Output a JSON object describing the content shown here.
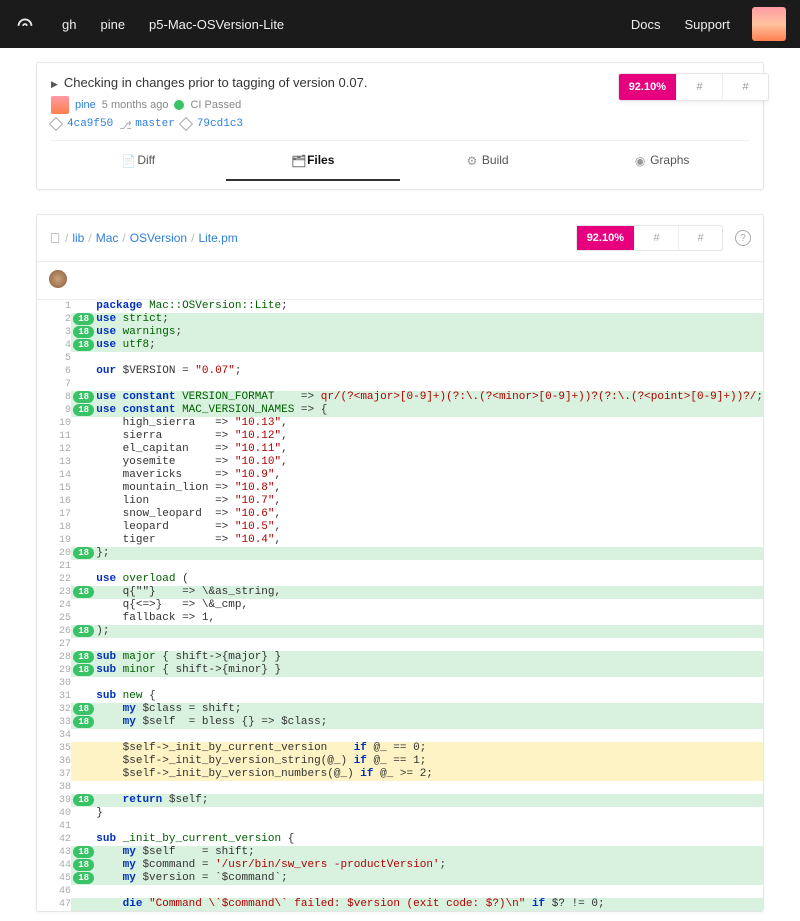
{
  "topbar": {
    "links": [
      "gh",
      "pine",
      "p5-Mac-OSVersion-Lite"
    ],
    "right": [
      "Docs",
      "Support"
    ]
  },
  "commit": {
    "title": "Checking in changes prior to tagging of version 0.07.",
    "author": "pine",
    "age": "5 months ago",
    "ci": "CI Passed",
    "sha": "4ca9f50",
    "branch": "master",
    "tree": "79cd1c3"
  },
  "coverage_top": {
    "pct": "92.10%",
    "a": "#",
    "b": "#"
  },
  "tabs": [
    "Diff",
    "Files",
    "Build",
    "Graphs"
  ],
  "active_tab": 1,
  "breadcrumbs": [
    "lib",
    "Mac",
    "OSVersion",
    "Lite.pm"
  ],
  "coverage_file": {
    "pct": "92.10%",
    "a": "#",
    "b": "#"
  },
  "lines": [
    {
      "n": 1,
      "h": "",
      "bg": "",
      "html": "<span class='k'>package</span> <span class='n'>Mac::OSVersion::Lite</span>;"
    },
    {
      "n": 2,
      "h": "18",
      "bg": "g",
      "html": "<span class='k'>use</span> <span class='n'>strict</span>;"
    },
    {
      "n": 3,
      "h": "18",
      "bg": "g",
      "html": "<span class='k'>use</span> <span class='n'>warnings</span>;"
    },
    {
      "n": 4,
      "h": "18",
      "bg": "g",
      "html": "<span class='k'>use</span> <span class='n'>utf8</span>;"
    },
    {
      "n": 5,
      "h": "",
      "bg": "",
      "html": ""
    },
    {
      "n": 6,
      "h": "",
      "bg": "",
      "html": "<span class='k'>our</span> $VERSION = <span class='s'>\"0.07\"</span>;"
    },
    {
      "n": 7,
      "h": "",
      "bg": "",
      "html": ""
    },
    {
      "n": 8,
      "h": "18",
      "bg": "g",
      "html": "<span class='k'>use constant</span> <span class='n'>VERSION_FORMAT</span>    =&gt; <span class='s'>qr/(?&lt;major&gt;[0-9]+)(?:\\.(?&lt;minor&gt;[0-9]+))?(?:\\.(?&lt;point&gt;[0-9]+))?/</span>;"
    },
    {
      "n": 9,
      "h": "18",
      "bg": "g",
      "html": "<span class='k'>use constant</span> <span class='n'>MAC_VERSION_NAMES</span> =&gt; {"
    },
    {
      "n": 10,
      "h": "",
      "bg": "",
      "html": "    high_sierra   =&gt; <span class='s'>\"10.13\"</span>,"
    },
    {
      "n": 11,
      "h": "",
      "bg": "",
      "html": "    sierra        =&gt; <span class='s'>\"10.12\"</span>,"
    },
    {
      "n": 12,
      "h": "",
      "bg": "",
      "html": "    el_capitan    =&gt; <span class='s'>\"10.11\"</span>,"
    },
    {
      "n": 13,
      "h": "",
      "bg": "",
      "html": "    yosemite      =&gt; <span class='s'>\"10.10\"</span>,"
    },
    {
      "n": 14,
      "h": "",
      "bg": "",
      "html": "    mavericks     =&gt; <span class='s'>\"10.9\"</span>,"
    },
    {
      "n": 15,
      "h": "",
      "bg": "",
      "html": "    mountain_lion =&gt; <span class='s'>\"10.8\"</span>,"
    },
    {
      "n": 16,
      "h": "",
      "bg": "",
      "html": "    lion          =&gt; <span class='s'>\"10.7\"</span>,"
    },
    {
      "n": 17,
      "h": "",
      "bg": "",
      "html": "    snow_leopard  =&gt; <span class='s'>\"10.6\"</span>,"
    },
    {
      "n": 18,
      "h": "",
      "bg": "",
      "html": "    leopard       =&gt; <span class='s'>\"10.5\"</span>,"
    },
    {
      "n": 19,
      "h": "",
      "bg": "",
      "html": "    tiger         =&gt; <span class='s'>\"10.4\"</span>,"
    },
    {
      "n": 20,
      "h": "18",
      "bg": "g",
      "html": "};"
    },
    {
      "n": 21,
      "h": "",
      "bg": "",
      "html": ""
    },
    {
      "n": 22,
      "h": "",
      "bg": "",
      "html": "<span class='k'>use</span> <span class='n'>overload</span> ("
    },
    {
      "n": 23,
      "h": "18",
      "bg": "g",
      "html": "    q{\"\"}    =&gt; \\&amp;as_string,"
    },
    {
      "n": 24,
      "h": "",
      "bg": "",
      "html": "    q{&lt;=&gt;}   =&gt; \\&amp;_cmp,"
    },
    {
      "n": 25,
      "h": "",
      "bg": "",
      "html": "    fallback =&gt; 1,"
    },
    {
      "n": 26,
      "h": "18",
      "bg": "g",
      "html": ");"
    },
    {
      "n": 27,
      "h": "",
      "bg": "",
      "html": ""
    },
    {
      "n": 28,
      "h": "18",
      "bg": "g",
      "html": "<span class='k'>sub</span> <span class='f'>major</span> { shift-&gt;{major} }"
    },
    {
      "n": 29,
      "h": "18",
      "bg": "g",
      "html": "<span class='k'>sub</span> <span class='f'>minor</span> { shift-&gt;{minor} }"
    },
    {
      "n": 30,
      "h": "",
      "bg": "",
      "html": ""
    },
    {
      "n": 31,
      "h": "",
      "bg": "",
      "html": "<span class='k'>sub</span> <span class='f'>new</span> {"
    },
    {
      "n": 32,
      "h": "18",
      "bg": "g",
      "html": "    <span class='k'>my</span> $class = shift;"
    },
    {
      "n": 33,
      "h": "18",
      "bg": "g",
      "html": "    <span class='k'>my</span> $self  = bless {} =&gt; $class;"
    },
    {
      "n": 34,
      "h": "",
      "bg": "",
      "html": ""
    },
    {
      "n": 35,
      "h": "",
      "bg": "y",
      "html": "    $self-&gt;_init_by_current_version    <span class='k'>if</span> @_ == 0;"
    },
    {
      "n": 36,
      "h": "",
      "bg": "y",
      "html": "    $self-&gt;_init_by_version_string(@_) <span class='k'>if</span> @_ == 1;"
    },
    {
      "n": 37,
      "h": "",
      "bg": "y",
      "html": "    $self-&gt;_init_by_version_numbers(@_) <span class='k'>if</span> @_ &gt;= 2;"
    },
    {
      "n": 38,
      "h": "",
      "bg": "",
      "html": ""
    },
    {
      "n": 39,
      "h": "18",
      "bg": "g",
      "html": "    <span class='k'>return</span> $self;"
    },
    {
      "n": 40,
      "h": "",
      "bg": "",
      "html": "}"
    },
    {
      "n": 41,
      "h": "",
      "bg": "",
      "html": ""
    },
    {
      "n": 42,
      "h": "",
      "bg": "",
      "html": "<span class='k'>sub</span> <span class='f'>_init_by_current_version</span> {"
    },
    {
      "n": 43,
      "h": "18",
      "bg": "g",
      "html": "    <span class='k'>my</span> $self    = shift;"
    },
    {
      "n": 44,
      "h": "18",
      "bg": "g",
      "html": "    <span class='k'>my</span> $command = <span class='s'>'/usr/bin/sw_vers -productVersion'</span>;"
    },
    {
      "n": 45,
      "h": "18",
      "bg": "g",
      "html": "    <span class='k'>my</span> $version = `$command`;"
    },
    {
      "n": 46,
      "h": "",
      "bg": "",
      "html": ""
    },
    {
      "n": 47,
      "h": "",
      "bg": "g",
      "html": "    <span class='k'>die</span> <span class='s'>\"Command \\`$command\\` failed: $version (exit code: $?)\\n\"</span> <span class='k'>if</span> $? != 0;"
    }
  ]
}
